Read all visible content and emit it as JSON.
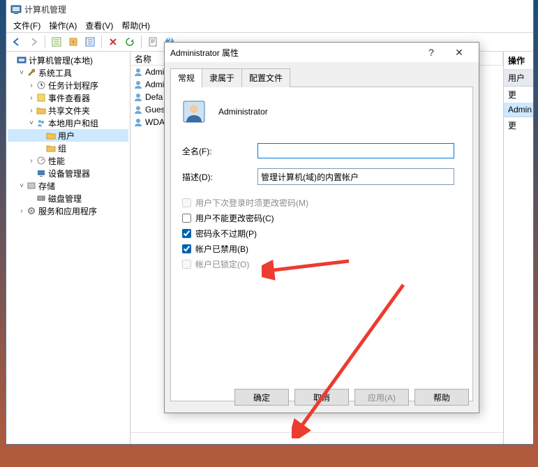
{
  "mainWindow": {
    "title": "计算机管理",
    "menu": {
      "file": "文件(F)",
      "action": "操作(A)",
      "view": "查看(V)",
      "help": "帮助(H)"
    }
  },
  "tree": {
    "root": "计算机管理(本地)",
    "sysTools": "系统工具",
    "taskSched": "任务计划程序",
    "eventViewer": "事件查看器",
    "sharedFolders": "共享文件夹",
    "localUsersGroups": "本地用户和组",
    "users": "用户",
    "groups": "组",
    "perf": "性能",
    "devmgr": "设备管理器",
    "storage": "存储",
    "diskmgr": "磁盘管理",
    "services": "服务和应用程序"
  },
  "list": {
    "headerName": "名称",
    "rows": [
      "Admini",
      "Admini",
      "Defa",
      "Gues",
      "WDA"
    ]
  },
  "rightPane": {
    "header": "操作",
    "tab1": "用户",
    "more1": "更",
    "tab2": "Admin",
    "more2": "更"
  },
  "dialog": {
    "title": "Administrator 属性",
    "tabs": {
      "general": "常规",
      "memberOf": "隶属于",
      "profile": "配置文件"
    },
    "username": "Administrator",
    "labelFullName": "全名(F):",
    "labelDesc": "描述(D):",
    "valueFullName": "",
    "valueDesc": "管理计算机(域)的内置帐户",
    "chkChangeNext": "用户下次登录时须更改密码(M)",
    "chkCannotChange": "用户不能更改密码(C)",
    "chkNeverExpire": "密码永不过期(P)",
    "chkDisabled": "帐户已禁用(B)",
    "chkLocked": "帐户已锁定(O)",
    "btnOK": "确定",
    "btnCancel": "取消",
    "btnApply": "应用(A)",
    "btnHelp": "帮助"
  }
}
